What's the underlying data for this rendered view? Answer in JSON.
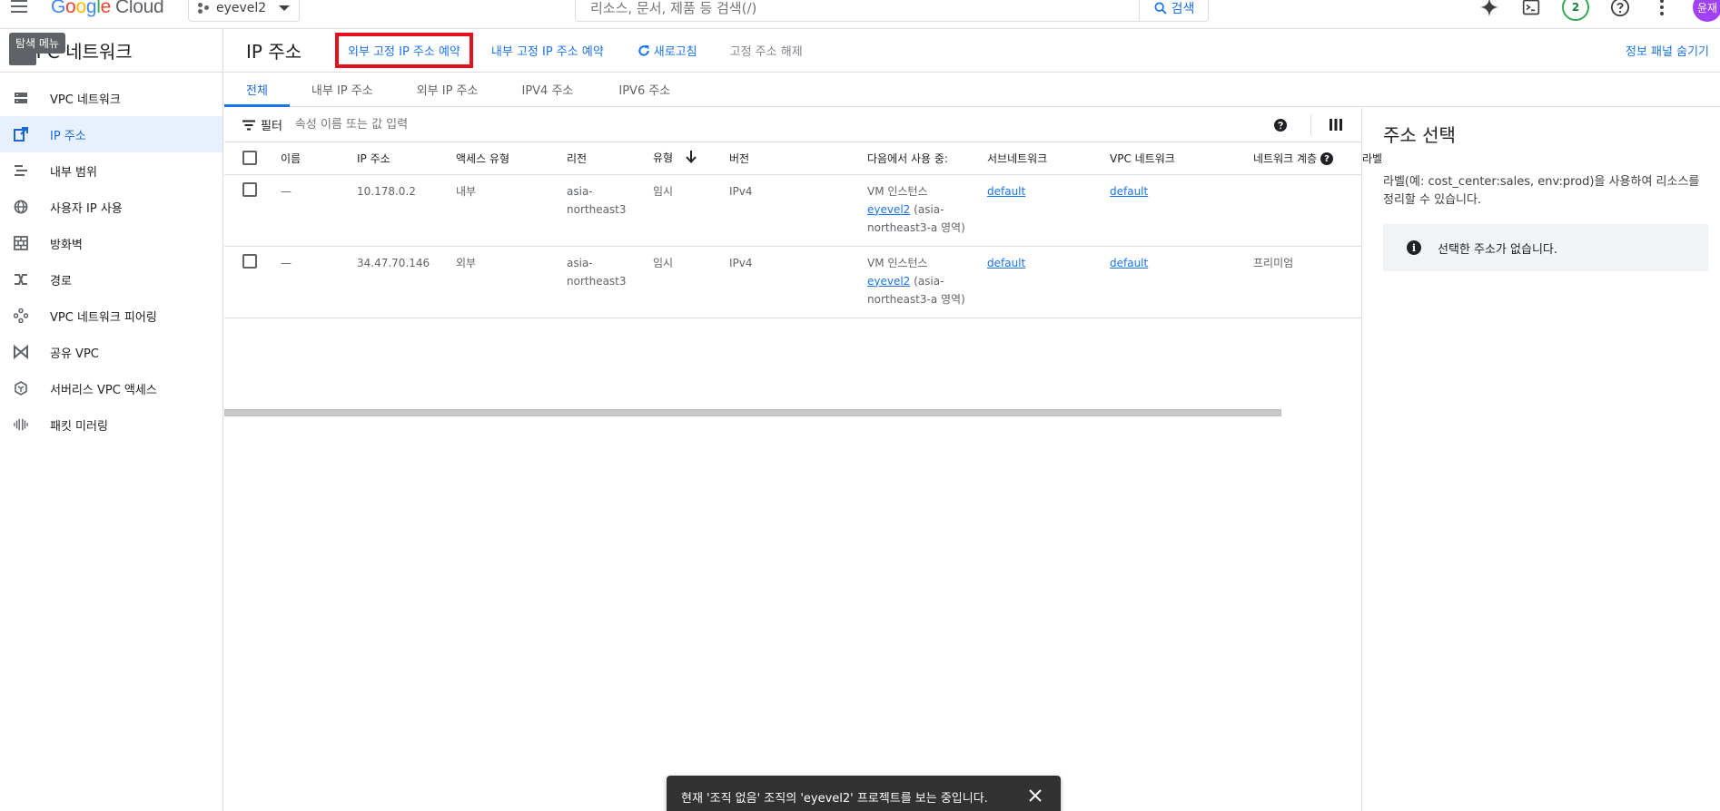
{
  "topbar": {
    "logo_letters": [
      "G",
      "o",
      "o",
      "g",
      "l",
      "e"
    ],
    "logo_cloud": "Cloud",
    "project_name": "eyevel2",
    "search_placeholder": "리소스, 문서, 제품 등 검색(/)",
    "search_button": "검색",
    "notifications_count": "2",
    "avatar_initials": "윤재"
  },
  "leftnav": {
    "tooltip": "탐색 메뉴",
    "title": "VPC 네트워크",
    "items": [
      {
        "label": "VPC 네트워크",
        "icon": "vpc-network-icon"
      },
      {
        "label": "IP 주소",
        "icon": "ip-address-icon",
        "active": true
      },
      {
        "label": "내부 범위",
        "icon": "internal-range-icon"
      },
      {
        "label": "사용자 IP 사용",
        "icon": "globe-icon"
      },
      {
        "label": "방화벽",
        "icon": "firewall-icon"
      },
      {
        "label": "경로",
        "icon": "route-icon"
      },
      {
        "label": "VPC 네트워크 피어링",
        "icon": "peering-icon"
      },
      {
        "label": "공유 VPC",
        "icon": "shared-vpc-icon"
      },
      {
        "label": "서버리스 VPC 액세스",
        "icon": "serverless-icon"
      },
      {
        "label": "패킷 미러링",
        "icon": "packet-mirroring-icon"
      }
    ]
  },
  "actionbar": {
    "page_title": "IP 주소",
    "reserve_external": "외부 고정 IP 주소 예약",
    "reserve_internal": "내부 고정 IP 주소 예약",
    "refresh": "새로고침",
    "release": "고정 주소 해제",
    "hide_info_panel": "정보 패널 숨기기"
  },
  "tabs": [
    "전체",
    "내부 IP 주소",
    "외부 IP 주소",
    "IPV4 주소",
    "IPV6 주소"
  ],
  "filter": {
    "label": "필터",
    "placeholder": "속성 이름 또는 값 입력"
  },
  "table": {
    "headers": [
      "이름",
      "IP 주소",
      "액세스 유형",
      "리전",
      "유형",
      "버전",
      "다음에서 사용 중:",
      "서브네트워크",
      "VPC 네트워크",
      "네트워크 계층",
      "라벨"
    ],
    "rows": [
      {
        "name": "—",
        "ip": "10.178.0.2",
        "access": "내부",
        "region_1": "asia-",
        "region_2": "northeast3",
        "type": "임시",
        "version": "IPv4",
        "used_by_1": "VM 인스턴스",
        "used_by_link": "eyevel2",
        "used_by_2": " (asia-",
        "used_by_3": "northeast3-a 영역)",
        "subnetwork": "default",
        "vpc": "default",
        "tier": ""
      },
      {
        "name": "—",
        "ip": "34.47.70.146",
        "access": "외부",
        "region_1": "asia-",
        "region_2": "northeast3",
        "type": "임시",
        "version": "IPv4",
        "used_by_1": "VM 인스턴스",
        "used_by_link": "eyevel2",
        "used_by_2": " (asia-",
        "used_by_3": "northeast3-a 영역)",
        "subnetwork": "default",
        "vpc": "default",
        "tier": "프리미엄"
      }
    ]
  },
  "info_panel": {
    "title": "주소 선택",
    "description": "라벨(예: cost_center:sales, env:prod)을 사용하여 리소스를 정리할 수 있습니다.",
    "empty_message": "선택한 주소가 없습니다."
  },
  "snackbar": {
    "message": "현재 '조직 없음' 조직의 'eyevel2' 프로젝트를 보는 중입니다."
  },
  "colors": {
    "accent": "#1a73e8",
    "highlight_border": "#e5101b",
    "active_nav_bg": "#e8f0fe"
  }
}
